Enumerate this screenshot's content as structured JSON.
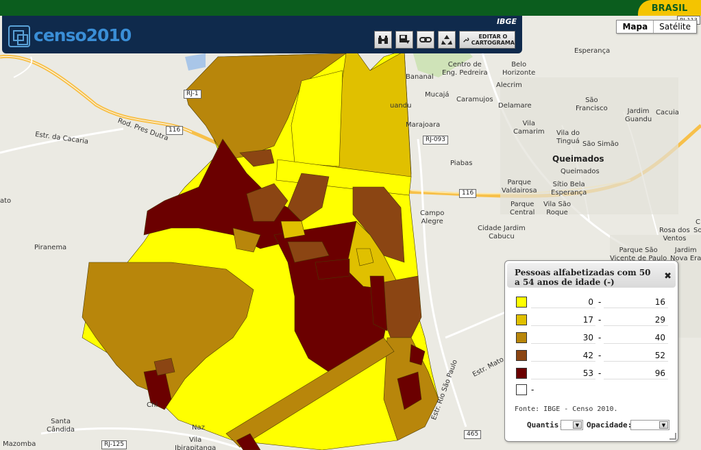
{
  "brand": {
    "gov_label": "BRASIL",
    "app_title": "censo2010",
    "agency": "IBGE"
  },
  "toolbar": {
    "edit_label_1": "EDITAR O",
    "edit_label_2": "CARTOGRAMA"
  },
  "maptype": {
    "map": "Mapa",
    "satellite": "Satélite"
  },
  "legend": {
    "title": "Pessoas alfabetizadas com 50 a 54 anos de idade (-)",
    "classes": [
      {
        "min": "0",
        "max": "16",
        "color": "#ffff00"
      },
      {
        "min": "17",
        "max": "29",
        "color": "#e0c000"
      },
      {
        "min": "30",
        "max": "40",
        "color": "#b8860b"
      },
      {
        "min": "42",
        "max": "52",
        "color": "#8b4513"
      },
      {
        "min": "53",
        "max": "96",
        "color": "#6b0000"
      }
    ],
    "nodata_label": "-",
    "nodata_color": "#ffffff",
    "source": "Fonte: IBGE - Censo 2010.",
    "quantis_label": "Quantis:",
    "opacidade_label": "Opacidade:"
  },
  "places": {
    "esperanca": "Esperança",
    "centro_eng_pedreira": "Centro de\nEng. Pedreira",
    "belo_horizonte": "Belo\nHorizonte",
    "bananal": "Bananal",
    "mucaja": "Mucajá",
    "caramujos": "Caramujos",
    "alecrim": "Alecrim",
    "delamare": "Delamare",
    "sao_francisco": "São\nFrancisco",
    "jardim_guandu": "Jardim\nGuandu",
    "cacuia": "Cacuia",
    "guandu": "uandu",
    "marajoara": "Marajoara",
    "vila_camarim": "Vila\nCamarim",
    "vila_tingua": "Vila do\nTinguá",
    "sao_simao": "São Simão",
    "queimados_city": "Queimados",
    "queimados": "Queimados",
    "piabas": "Piabas",
    "parque_valdairosa": "Parque\nValdairosa",
    "sitio_bela_esperanca": "Sítio Bela\nEsperança",
    "parque_central": "Parque\nCentral",
    "vila_sao_roque": "Vila São\nRoque",
    "campo_alegre": "Campo\nAlegre",
    "cidade_jardim_cabucu": "Cidade Jardim\nCabucu",
    "rosa_dos_ventos": "Rosa dos\nVentos",
    "so_right": "So",
    "c_right": "C",
    "parque_sao_vicente": "Parque São\nVicente de Paulo",
    "jardim_nova_era": "Jardim\nNova Era",
    "piranema": "Piranema",
    "ato": "ato",
    "santa_candida": "Santa\nCândida",
    "mazomba": "Mazomba",
    "vila_ibirapitanga": "Vila\nIbirapitanga",
    "naz": "Naz",
    "chi": "Chi",
    "rod_pres_dutra": "Rod. Pres Dutra",
    "estr_cacaria": "Estr. da Cacaria",
    "estr_mato_grosso": "Estr. Mato Grosso",
    "estr_rio_sao_paulo": "Estr. Rio São Paulo"
  },
  "shields": {
    "rj_093": "RJ-093",
    "br_116_a": "116",
    "br_116_b": "116",
    "rj_125": "RJ-125",
    "br_465": "465",
    "rj_left": "RJ-1",
    "rj_top_right": "RJ-113"
  }
}
